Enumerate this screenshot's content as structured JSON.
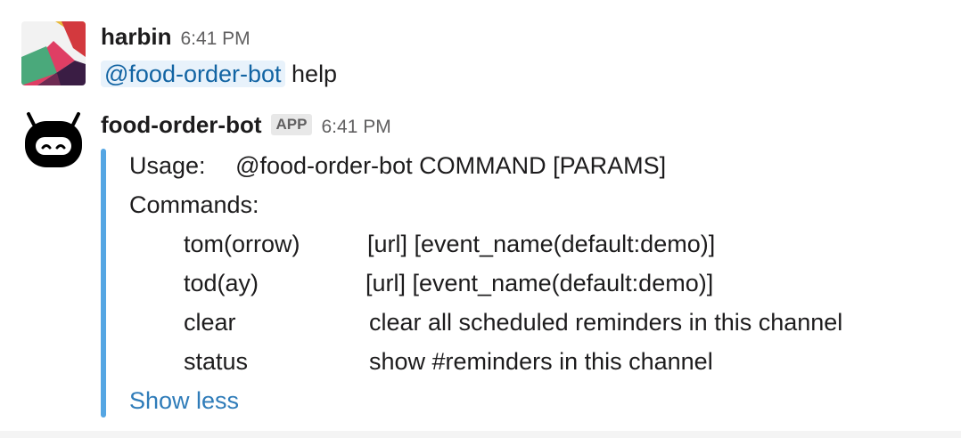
{
  "messages": [
    {
      "author": "harbin",
      "time": "6:41 PM",
      "mention": "@food-order-bot",
      "text": "help"
    },
    {
      "author": "food-order-bot",
      "badge": "APP",
      "time": "6:41 PM",
      "attachment": {
        "usage_label": "Usage:",
        "usage_value": "@food-order-bot COMMAND [PARAMS]",
        "commands_label": "Commands:",
        "commands": [
          {
            "name": "tom(orrow)",
            "desc": "[url] [event_name(default:demo)]"
          },
          {
            "name": "tod(ay)",
            "desc": "[url] [event_name(default:demo)]"
          },
          {
            "name": "clear",
            "desc": "clear all scheduled reminders in this channel"
          },
          {
            "name": "status",
            "desc": "show #reminders in this channel"
          }
        ],
        "show_less": "Show less",
        "bar_color": "#55a6e3"
      }
    }
  ],
  "colors": {
    "mention_text": "#1264a3",
    "mention_bg": "#e8f2fb",
    "link": "#2f7cb9",
    "timestamp": "#616061"
  },
  "icons": {
    "user_avatar": "slack-multicolor-avatar",
    "bot_avatar": "robot-face-avatar"
  }
}
